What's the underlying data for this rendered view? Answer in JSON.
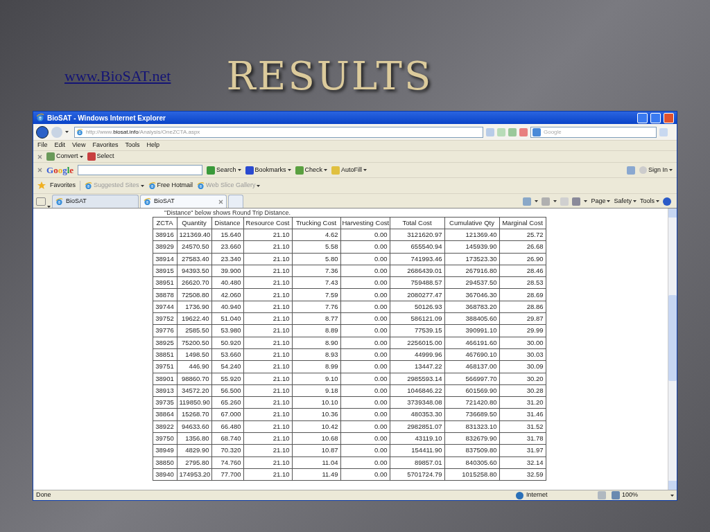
{
  "slide": {
    "link": "www.BioSAT.net",
    "title": "RESULTS"
  },
  "browser": {
    "title": "BioSAT - Windows Internet Explorer",
    "address": {
      "prefix": "http://www.",
      "domain": "biosat.info",
      "path": "/Analysis/OneZCTA.aspx"
    },
    "search_placeholder": "Google",
    "menu": [
      "File",
      "Edit",
      "View",
      "Favorites",
      "Tools",
      "Help"
    ],
    "convert_bar": [
      "Convert",
      "Select"
    ],
    "google_bar": {
      "logo": "Google",
      "items": [
        "Search",
        "Bookmarks",
        "Check",
        "AutoFill"
      ],
      "sign_in": "Sign In"
    },
    "favorites_bar": {
      "label": "Favorites",
      "links": [
        {
          "label": "Suggested Sites",
          "disabled": true
        },
        {
          "label": "Free Hotmail",
          "disabled": false
        },
        {
          "label": "Web Slice Gallery",
          "disabled": true
        }
      ]
    },
    "tabs": [
      {
        "label": "BioSAT",
        "selected": false
      },
      {
        "label": "BioSAT",
        "selected": true
      }
    ],
    "command_bar": [
      "Page",
      "Safety",
      "Tools"
    ],
    "page": {
      "note": "\"Distance\" below shows Round Trip Distance.",
      "table": {
        "columns": [
          "ZCTA",
          "Quantity",
          "Distance",
          "Resource Cost",
          "Trucking Cost",
          "Harvesting Cost",
          "Total Cost",
          "Cumulative Qty",
          "Marginal Cost"
        ],
        "rows": [
          [
            "38916",
            "121369.40",
            "15.640",
            "21.10",
            "4.62",
            "0.00",
            "3121620.97",
            "121369.40",
            "25.72"
          ],
          [
            "38929",
            "24570.50",
            "23.660",
            "21.10",
            "5.58",
            "0.00",
            "655540.94",
            "145939.90",
            "26.68"
          ],
          [
            "38914",
            "27583.40",
            "23.340",
            "21.10",
            "5.80",
            "0.00",
            "741993.46",
            "173523.30",
            "26.90"
          ],
          [
            "38915",
            "94393.50",
            "39.900",
            "21.10",
            "7.36",
            "0.00",
            "2686439.01",
            "267916.80",
            "28.46"
          ],
          [
            "38951",
            "26620.70",
            "40.480",
            "21.10",
            "7.43",
            "0.00",
            "759488.57",
            "294537.50",
            "28.53"
          ],
          [
            "38878",
            "72508.80",
            "42.060",
            "21.10",
            "7.59",
            "0.00",
            "2080277.47",
            "367046.30",
            "28.69"
          ],
          [
            "39744",
            "1736.90",
            "40.940",
            "21.10",
            "7.76",
            "0.00",
            "50126.93",
            "368783.20",
            "28.86"
          ],
          [
            "39752",
            "19622.40",
            "51.040",
            "21.10",
            "8.77",
            "0.00",
            "586121.09",
            "388405.60",
            "29.87"
          ],
          [
            "39776",
            "2585.50",
            "53.980",
            "21.10",
            "8.89",
            "0.00",
            "77539.15",
            "390991.10",
            "29.99"
          ],
          [
            "38925",
            "75200.50",
            "50.920",
            "21.10",
            "8.90",
            "0.00",
            "2256015.00",
            "466191.60",
            "30.00"
          ],
          [
            "38851",
            "1498.50",
            "53.660",
            "21.10",
            "8.93",
            "0.00",
            "44999.96",
            "467690.10",
            "30.03"
          ],
          [
            "39751",
            "446.90",
            "54.240",
            "21.10",
            "8.99",
            "0.00",
            "13447.22",
            "468137.00",
            "30.09"
          ],
          [
            "38901",
            "98860.70",
            "55.920",
            "21.10",
            "9.10",
            "0.00",
            "2985593.14",
            "566997.70",
            "30.20"
          ],
          [
            "38913",
            "34572.20",
            "56.500",
            "21.10",
            "9.18",
            "0.00",
            "1046846.22",
            "601569.90",
            "30.28"
          ],
          [
            "39735",
            "119850.90",
            "65.260",
            "21.10",
            "10.10",
            "0.00",
            "3739348.08",
            "721420.80",
            "31.20"
          ],
          [
            "38864",
            "15268.70",
            "67.000",
            "21.10",
            "10.36",
            "0.00",
            "480353.30",
            "736689.50",
            "31.46"
          ],
          [
            "38922",
            "94633.60",
            "66.480",
            "21.10",
            "10.42",
            "0.00",
            "2982851.07",
            "831323.10",
            "31.52"
          ],
          [
            "39750",
            "1356.80",
            "68.740",
            "21.10",
            "10.68",
            "0.00",
            "43119.10",
            "832679.90",
            "31.78"
          ],
          [
            "38949",
            "4829.90",
            "70.320",
            "21.10",
            "10.87",
            "0.00",
            "154411.90",
            "837509.80",
            "31.97"
          ],
          [
            "38850",
            "2795.80",
            "74.760",
            "21.10",
            "11.04",
            "0.00",
            "89857.01",
            "840305.60",
            "32.14"
          ],
          [
            "38940",
            "174953.20",
            "77.700",
            "21.10",
            "11.49",
            "0.00",
            "5701724.79",
            "1015258.80",
            "32.59"
          ]
        ]
      }
    },
    "status_bar": {
      "text": "Done",
      "zone": "Internet",
      "zoom": "100%"
    }
  }
}
